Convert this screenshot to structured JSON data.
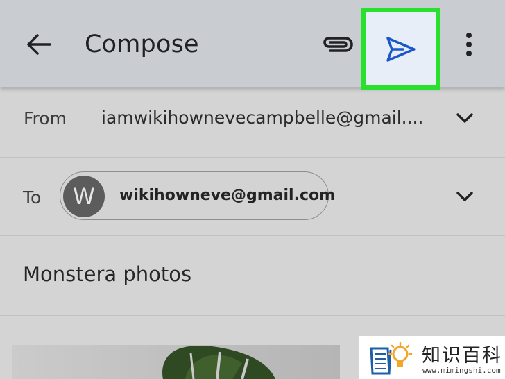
{
  "appbar": {
    "title": "Compose",
    "back_icon": "arrow-left-icon",
    "attach_icon": "paperclip-icon",
    "send_icon": "send-icon",
    "more_icon": "more-vert-icon"
  },
  "highlight_color": "#27e12c",
  "from": {
    "label": "From",
    "value": "iamwikihownevecampbelle@gmail...."
  },
  "to": {
    "label": "To",
    "avatar_initial": "W",
    "recipient": "wikihowneve@gmail.com"
  },
  "subject": {
    "value": "Monstera photos"
  },
  "watermark": {
    "chinese": "知识百科",
    "url": "www.mimingshi.com"
  }
}
